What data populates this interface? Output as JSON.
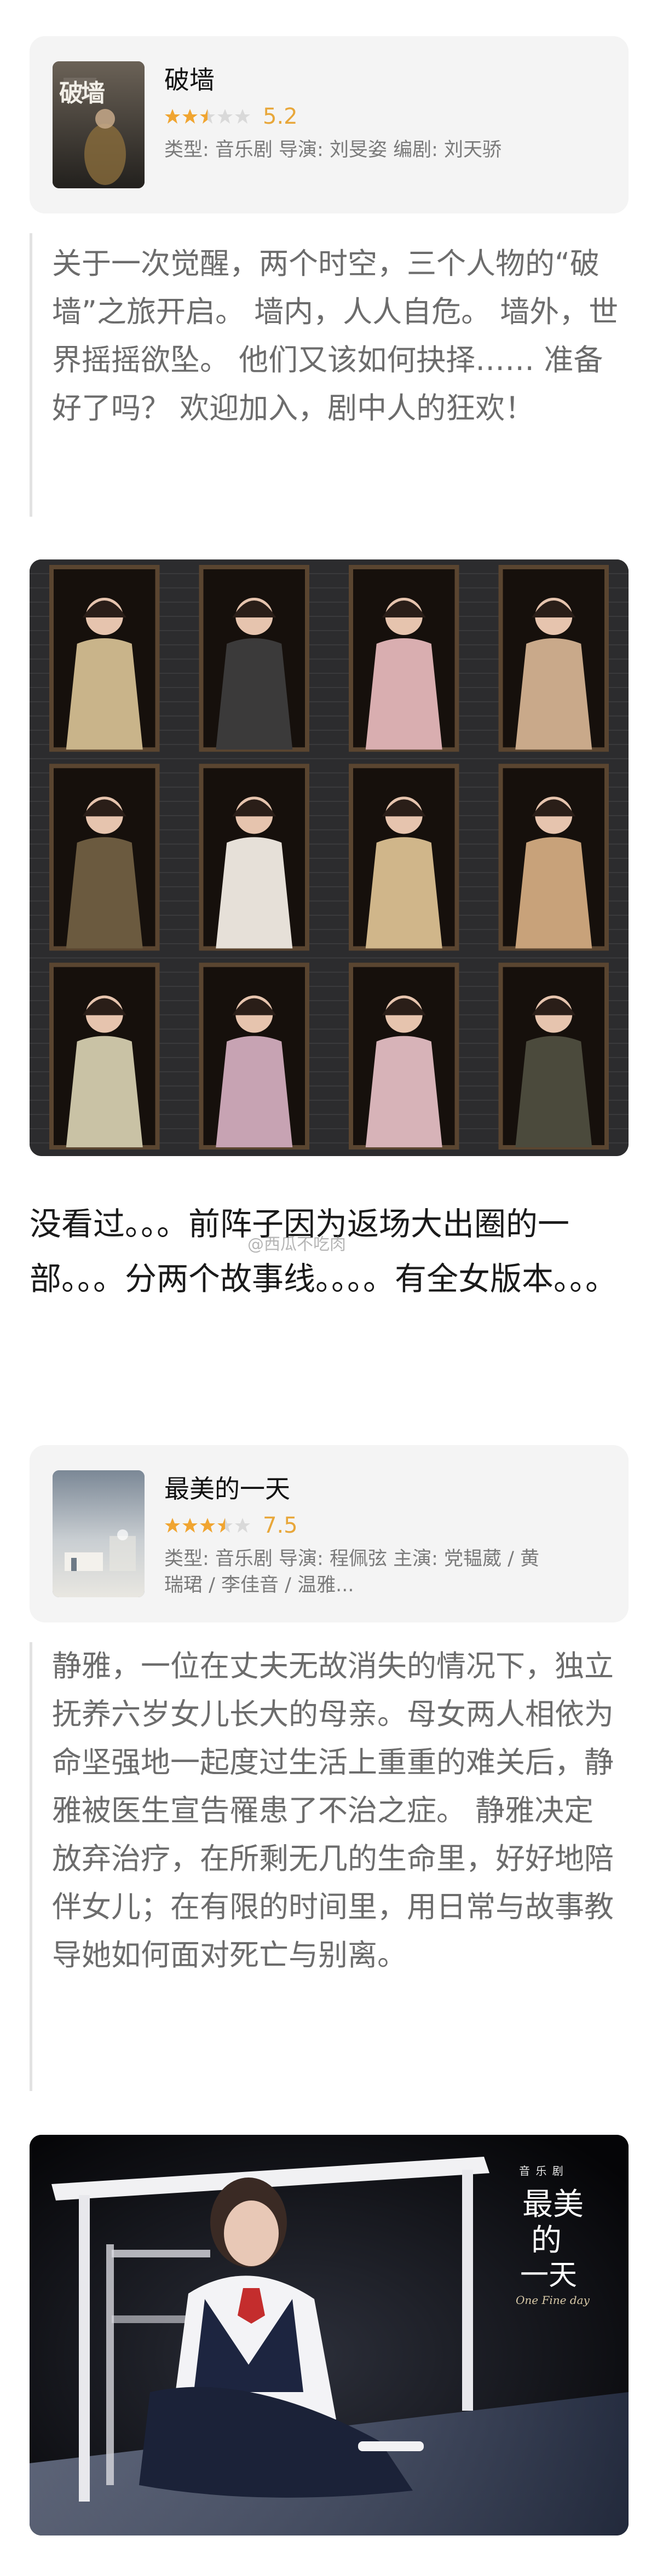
{
  "card1": {
    "title": "破墙",
    "score": "5.2",
    "stars_filled": 2.5,
    "meta": "类型: 音乐剧 导演: 刘旻姿 编剧: 刘天骄",
    "poster_text": "破墙"
  },
  "quote1": "关于一次觉醒，两个时空，三个人物的“破墙”之旅开启。 墙内，人人自危。 墙外，世界摇摇欲坠。 他们又该如何抉择…… 准备好了吗？ 欢迎加入，剧中人的狂欢！",
  "post_text": "没看过。。。前阵子因为返场大出圈的一部。。。分两个故事线。。。。有全女版本。。。",
  "watermark": "@西瓜不吃肉",
  "card2": {
    "title": "最美的一天",
    "score": "7.5",
    "stars_filled": 3.5,
    "meta": "类型: 音乐剧 导演: 程佩弦 主演: 党韫葳 / 黄瑞珺 / 李佳音 / 温雅..."
  },
  "quote2": "静雅，一位在丈夫无故消失的情况下，独立抚养六岁女儿长大的母亲。母女两人相依为命坚强地一起度过生活上重重的难关后，静雅被医生宣告罹患了不治之症。 静雅决定放弃治疗，在所剩无几的生命里，好好地陪伴女儿；在有限的时间里，用日常与故事教导她如何面对死亡与别离。",
  "photo2": {
    "label_small": "音 乐 剧",
    "title_line1": "最美",
    "title_line2": "的",
    "title_line3": "一天",
    "script": "One Fine day"
  },
  "colors": {
    "star_on": "#f0a531",
    "star_off": "#d9d9d9",
    "score": "#e8a73a",
    "card_bg": "#f4f4f4"
  }
}
